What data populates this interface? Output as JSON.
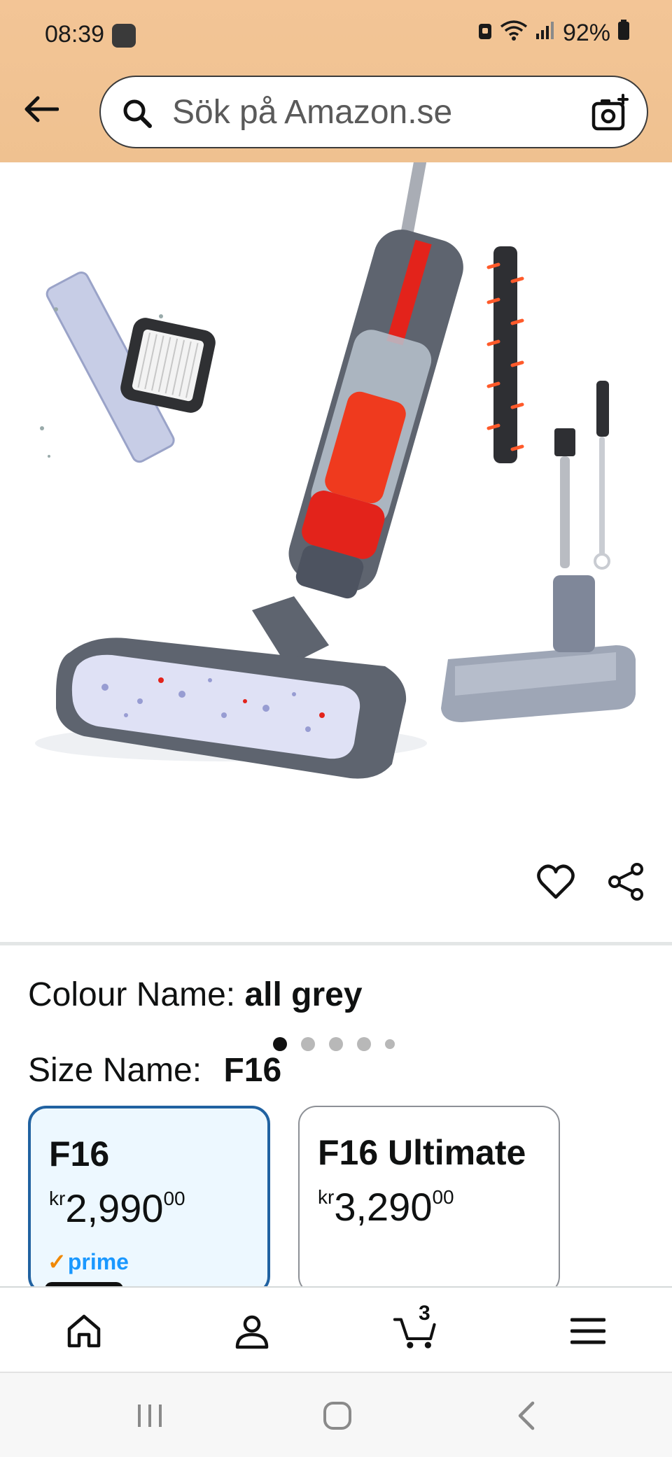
{
  "status_bar": {
    "time": "08:39",
    "battery": "92%"
  },
  "search": {
    "placeholder": "Sök på Amazon.se"
  },
  "gallery": {
    "image_count": 5,
    "active_index": 0
  },
  "variations": {
    "colour_label": "Colour Name:",
    "colour_value": "all grey",
    "size_label": "Size Name:",
    "size_value": "F16",
    "options": [
      {
        "name": "F16",
        "currency": "kr",
        "price_whole": "2,990",
        "price_fraction": "00",
        "prime": true,
        "selected": true
      },
      {
        "name": "F16 Ultimate",
        "currency": "kr",
        "price_whole": "3,290",
        "price_fraction": "00",
        "prime": false,
        "selected": false
      }
    ]
  },
  "prime_label": "prime",
  "bottom_nav": {
    "cart_count": "3",
    "items": [
      "home-icon",
      "account-icon",
      "cart-icon",
      "menu-icon"
    ]
  },
  "colors": {
    "header_bg": "#f3c596",
    "selected_border": "#2162a1",
    "selected_bg": "#edf8ff",
    "prime_blue": "#1a98ff",
    "prime_check": "#f08804"
  }
}
